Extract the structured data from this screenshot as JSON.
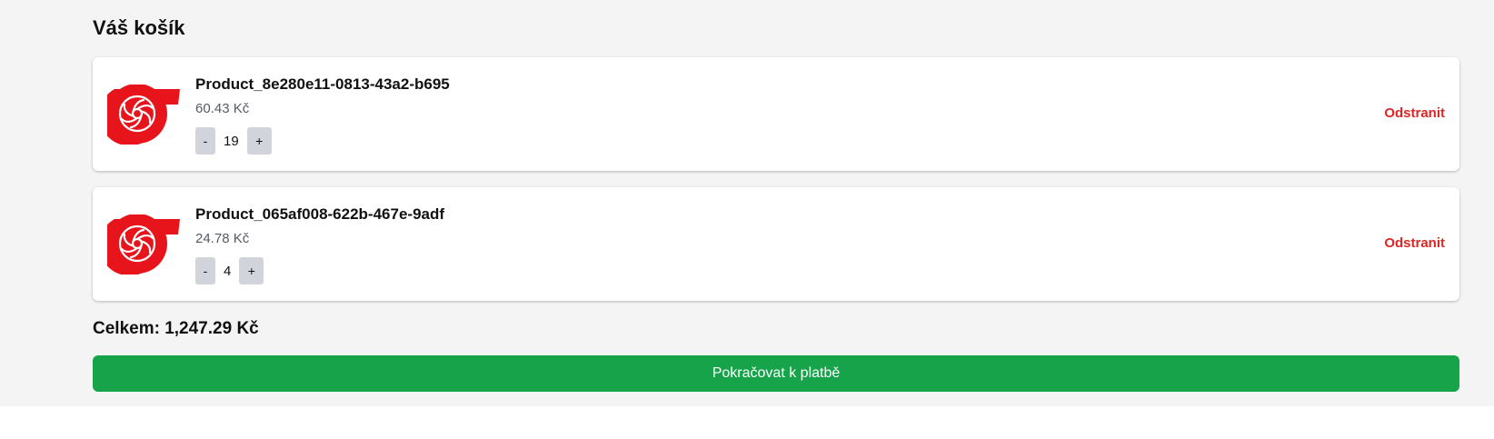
{
  "cart": {
    "title": "Váš košík",
    "items": [
      {
        "name": "Product_8e280e11-0813-43a2-b695",
        "price": "60.43 Kč",
        "quantity": "19",
        "decrease_label": "-",
        "increase_label": "+",
        "remove_label": "Odstranit",
        "image_icon": "red-turbo-fan-icon"
      },
      {
        "name": "Product_065af008-622b-467e-9adf",
        "price": "24.78 Kč",
        "quantity": "4",
        "decrease_label": "-",
        "increase_label": "+",
        "remove_label": "Odstranit",
        "image_icon": "red-turbo-fan-icon"
      }
    ],
    "total": "Celkem: 1,247.29 Kč",
    "checkout_label": "Pokračovat k platbě"
  },
  "colors": {
    "page_background": "#f4f4f4",
    "card_background": "#ffffff",
    "accent_red": "#e8141c",
    "remove_red": "#dc2626",
    "checkout_green": "#16a34a",
    "qty_button_gray": "#d1d5db",
    "price_gray": "#555b66"
  }
}
